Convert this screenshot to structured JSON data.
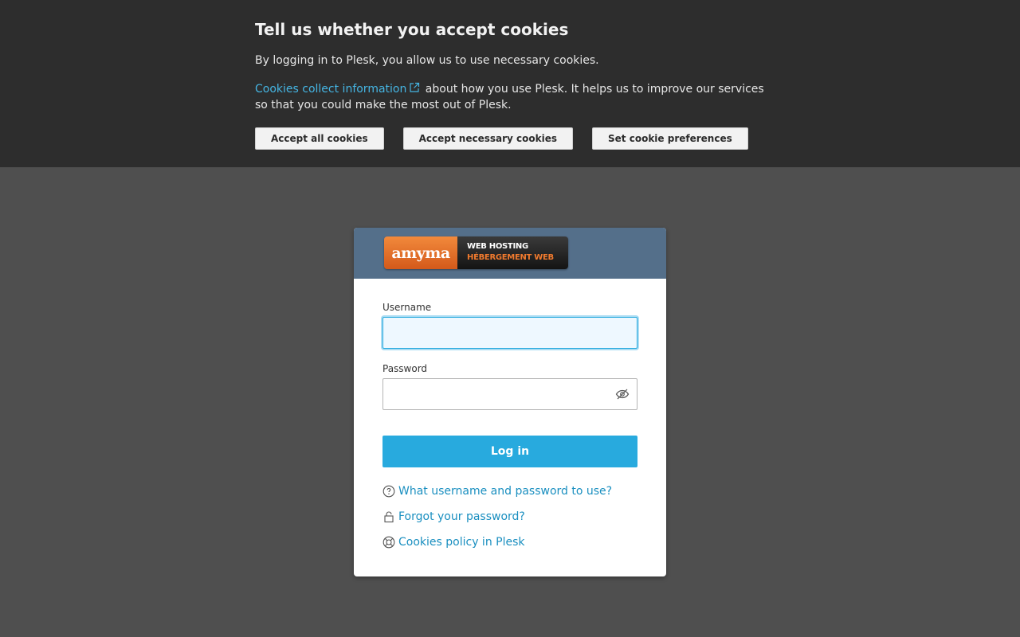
{
  "cookie_banner": {
    "title": "Tell us whether you accept cookies",
    "line1": "By logging in to Plesk, you allow us to use necessary cookies.",
    "info_link": "Cookies collect information",
    "info_rest": " about how you use Plesk. It helps us to improve our services so that you could make the most out of Plesk.",
    "buttons": {
      "accept_all": "Accept all cookies",
      "accept_necessary": "Accept necessary cookies",
      "preferences": "Set cookie preferences"
    },
    "colors": {
      "background": "#2d2d2d",
      "link": "#45b5e3"
    }
  },
  "logo": {
    "brand": "amyma",
    "line1": "WEB HOSTING",
    "line2": "HÉBERGEMENT WEB"
  },
  "login": {
    "username_label": "Username",
    "username_value": "",
    "password_label": "Password",
    "password_value": "",
    "submit_label": "Log in",
    "icons": {
      "password_toggle": "eye-slash-icon"
    },
    "links": [
      {
        "icon": "question-circle-icon",
        "label": "What username and password to use?"
      },
      {
        "icon": "lock-icon",
        "label": "Forgot your password?"
      },
      {
        "icon": "lifebuoy-icon",
        "label": "Cookies policy in Plesk"
      }
    ],
    "colors": {
      "header": "#546f8a",
      "button": "#28aade",
      "link": "#1a8fc0"
    }
  },
  "page": {
    "background": "#4f4f4f"
  }
}
